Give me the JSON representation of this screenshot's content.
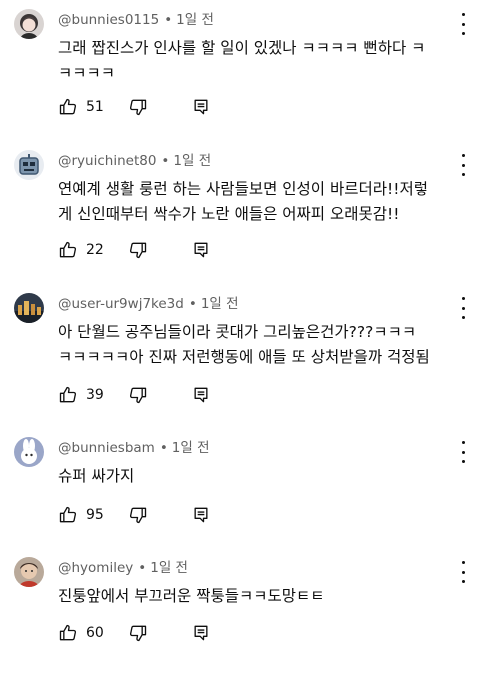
{
  "comments": [
    {
      "author": "@bunnies0115",
      "time": "1일 전",
      "text": "그래 짭진스가 인사를 할 일이 있겠나 ㅋㅋㅋㅋ 뻔하다 ㅋ\nㅋㅋㅋㅋ",
      "likes": "51",
      "avatar_icon": "avatar-anime-girl-icon"
    },
    {
      "author": "@ryuichinet80",
      "time": "1일 전",
      "text": "연예계 생활 룽런 하는 사람들보면 인성이 바르더라!!저렇\n게 신인때부터 싹수가 노란 애들은 어짜피 오래못감!!",
      "likes": "22",
      "avatar_icon": "avatar-robot-icon"
    },
    {
      "author": "@user-ur9wj7ke3d",
      "time": "1일 전",
      "text": "아 단월드 공주님들이라 콧대가 그리높은건가???ㅋㅋㅋ\nㅋㅋㅋㅋㅋ아 진짜 저런행동에 애들 또 상처받을까 걱정됨",
      "likes": "39",
      "avatar_icon": "avatar-city-icon"
    },
    {
      "author": "@bunniesbam",
      "time": "1일 전",
      "text": "슈퍼 싸가지",
      "likes": "95",
      "avatar_icon": "avatar-bunny-icon"
    },
    {
      "author": "@hyomiley",
      "time": "1일 전",
      "text": "진퉁앞에서 부끄러운 짝퉁들ㅋㅋ도망ㅌㅌ",
      "likes": "60",
      "avatar_icon": "avatar-photo-icon"
    }
  ],
  "icons": {
    "like": "thumbs-up-icon",
    "dislike": "thumbs-down-icon",
    "reply": "reply-icon",
    "more": "more-vert-icon"
  },
  "colors": {
    "meta_text": "#606060",
    "body_text": "#0f0f0f"
  }
}
